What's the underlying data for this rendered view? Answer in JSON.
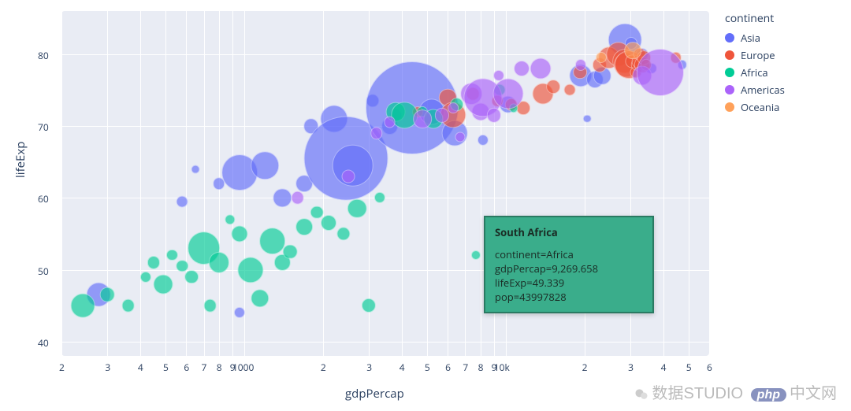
{
  "chart_data": {
    "type": "scatter",
    "xlabel": "gdpPercap",
    "ylabel": "lifeExp",
    "xscale": "log",
    "xlim": [
      200,
      60000
    ],
    "ylim": [
      38,
      86
    ],
    "grid": true,
    "legend_title": "continent",
    "legend_position": "right",
    "size_variable": "pop",
    "series": [
      {
        "name": "Asia",
        "color": "#636efa",
        "points": [
          {
            "x": 277,
            "y": 46.5,
            "pop": 55000000
          },
          {
            "x": 580,
            "y": 59.5,
            "pop": 5000000
          },
          {
            "x": 650,
            "y": 64,
            "pop": 900000
          },
          {
            "x": 800,
            "y": 62,
            "pop": 6000000
          },
          {
            "x": 960,
            "y": 63.5,
            "pop": 150000000
          },
          {
            "x": 960,
            "y": 44,
            "pop": 4000000
          },
          {
            "x": 1200,
            "y": 64.5,
            "pop": 80000000
          },
          {
            "x": 1400,
            "y": 60,
            "pop": 25000000
          },
          {
            "x": 1700,
            "y": 62,
            "pop": 20000000
          },
          {
            "x": 1800,
            "y": 70,
            "pop": 14000000
          },
          {
            "x": 2200,
            "y": 71,
            "pop": 78000000
          },
          {
            "x": 2450,
            "y": 65.5,
            "pop": 1034000000
          },
          {
            "x": 2600,
            "y": 64.5,
            "pop": 210000000
          },
          {
            "x": 3100,
            "y": 73.5,
            "pop": 9000000
          },
          {
            "x": 3600,
            "y": 70,
            "pop": 20000000
          },
          {
            "x": 3800,
            "y": 71.5,
            "pop": 6000000
          },
          {
            "x": 4400,
            "y": 72.5,
            "pop": 1280000000
          },
          {
            "x": 5200,
            "y": 72,
            "pop": 67000000
          },
          {
            "x": 6400,
            "y": 69,
            "pop": 65000000
          },
          {
            "x": 8200,
            "y": 68,
            "pop": 4000000
          },
          {
            "x": 10200,
            "y": 73,
            "pop": 23000000
          },
          {
            "x": 19400,
            "y": 77,
            "pop": 47000000
          },
          {
            "x": 20500,
            "y": 71,
            "pop": 700000
          },
          {
            "x": 22000,
            "y": 76.5,
            "pop": 21000000
          },
          {
            "x": 23400,
            "y": 77,
            "pop": 22000000
          },
          {
            "x": 28600,
            "y": 82,
            "pop": 127000000
          },
          {
            "x": 36000,
            "y": 78,
            "pop": 4200000
          },
          {
            "x": 33300,
            "y": 80,
            "pop": 6900000
          },
          {
            "x": 30200,
            "y": 81.5,
            "pop": 6700000
          },
          {
            "x": 47300,
            "y": 78.5,
            "pop": 2100000
          }
        ]
      },
      {
        "name": "Europe",
        "color": "#EF553B",
        "points": [
          {
            "x": 4600,
            "y": 72,
            "pop": 3500000
          },
          {
            "x": 6000,
            "y": 74,
            "pop": 22000000
          },
          {
            "x": 6300,
            "y": 71.5,
            "pop": 67000000
          },
          {
            "x": 7500,
            "y": 74.5,
            "pop": 8000000
          },
          {
            "x": 9300,
            "y": 73.5,
            "pop": 4500000
          },
          {
            "x": 10500,
            "y": 73,
            "pop": 7500000
          },
          {
            "x": 11700,
            "y": 72.5,
            "pop": 10000000
          },
          {
            "x": 13900,
            "y": 74.5,
            "pop": 38000000
          },
          {
            "x": 15200,
            "y": 75.5,
            "pop": 10000000
          },
          {
            "x": 17600,
            "y": 75,
            "pop": 5000000
          },
          {
            "x": 19200,
            "y": 77.5,
            "pop": 10000000
          },
          {
            "x": 22800,
            "y": 78.5,
            "pop": 10800000
          },
          {
            "x": 24800,
            "y": 79.5,
            "pop": 40000000
          },
          {
            "x": 27000,
            "y": 80,
            "pop": 58000000
          },
          {
            "x": 28500,
            "y": 79,
            "pop": 59000000
          },
          {
            "x": 28900,
            "y": 78.5,
            "pop": 60000000
          },
          {
            "x": 29500,
            "y": 78.5,
            "pop": 82000000
          },
          {
            "x": 30500,
            "y": 79,
            "pop": 9000000
          },
          {
            "x": 31500,
            "y": 77.5,
            "pop": 5400000
          },
          {
            "x": 31700,
            "y": 78.5,
            "pop": 4500000
          },
          {
            "x": 32200,
            "y": 79,
            "pop": 8000000
          },
          {
            "x": 32500,
            "y": 80,
            "pop": 7300000
          },
          {
            "x": 33200,
            "y": 78.5,
            "pop": 16000000
          },
          {
            "x": 33700,
            "y": 79.5,
            "pop": 10000000
          },
          {
            "x": 34400,
            "y": 78.5,
            "pop": 4000000
          },
          {
            "x": 44700,
            "y": 79.5,
            "pop": 4500000
          }
        ]
      },
      {
        "name": "Africa",
        "color": "#00cc96",
        "points": [
          {
            "x": 241,
            "y": 45,
            "pop": 55000000
          },
          {
            "x": 300,
            "y": 46.5,
            "pop": 12000000
          },
          {
            "x": 360,
            "y": 45,
            "pop": 8000000
          },
          {
            "x": 420,
            "y": 49,
            "pop": 4000000
          },
          {
            "x": 450,
            "y": 51,
            "pop": 7000000
          },
          {
            "x": 490,
            "y": 48,
            "pop": 30000000
          },
          {
            "x": 530,
            "y": 52,
            "pop": 4000000
          },
          {
            "x": 580,
            "y": 50.5,
            "pop": 6000000
          },
          {
            "x": 630,
            "y": 49,
            "pop": 10000000
          },
          {
            "x": 700,
            "y": 53,
            "pop": 120000000
          },
          {
            "x": 740,
            "y": 45,
            "pop": 8000000
          },
          {
            "x": 800,
            "y": 51,
            "pop": 35000000
          },
          {
            "x": 880,
            "y": 57,
            "pop": 3000000
          },
          {
            "x": 960,
            "y": 55,
            "pop": 18000000
          },
          {
            "x": 1060,
            "y": 50,
            "pop": 67000000
          },
          {
            "x": 1150,
            "y": 46,
            "pop": 25000000
          },
          {
            "x": 1280,
            "y": 54,
            "pop": 70000000
          },
          {
            "x": 1400,
            "y": 51,
            "pop": 16000000
          },
          {
            "x": 1500,
            "y": 52.5,
            "pop": 12000000
          },
          {
            "x": 1700,
            "y": 56,
            "pop": 20000000
          },
          {
            "x": 1900,
            "y": 58,
            "pop": 8000000
          },
          {
            "x": 2100,
            "y": 56.5,
            "pop": 15000000
          },
          {
            "x": 2400,
            "y": 55,
            "pop": 9000000
          },
          {
            "x": 2700,
            "y": 58.5,
            "pop": 29000000
          },
          {
            "x": 3000,
            "y": 45,
            "pop": 11000000
          },
          {
            "x": 3300,
            "y": 60,
            "pop": 4000000
          },
          {
            "x": 3800,
            "y": 72,
            "pop": 30000000
          },
          {
            "x": 4100,
            "y": 71.5,
            "pop": 68000000
          },
          {
            "x": 4800,
            "y": 72,
            "pop": 4000000
          },
          {
            "x": 5300,
            "y": 71,
            "pop": 31000000
          },
          {
            "x": 6500,
            "y": 73,
            "pop": 10000000
          },
          {
            "x": 7700,
            "y": 52,
            "pop": 1800000
          },
          {
            "x": 9270,
            "y": 49.3,
            "pop": 43997828
          },
          {
            "x": 9500,
            "y": 75,
            "pop": 5000000
          },
          {
            "x": 10700,
            "y": 72.5,
            "pop": 1200000
          },
          {
            "x": 12500,
            "y": 57,
            "pop": 450000
          }
        ]
      },
      {
        "name": "Americas",
        "color": "#ab63fa",
        "points": [
          {
            "x": 1600,
            "y": 60,
            "pop": 8000000
          },
          {
            "x": 2500,
            "y": 63,
            "pop": 8400000
          },
          {
            "x": 3200,
            "y": 69,
            "pop": 6000000
          },
          {
            "x": 3600,
            "y": 70.5,
            "pop": 5000000
          },
          {
            "x": 4800,
            "y": 71,
            "pop": 26000000
          },
          {
            "x": 5700,
            "y": 71.5,
            "pop": 11000000
          },
          {
            "x": 6300,
            "y": 72.5,
            "pop": 3400000
          },
          {
            "x": 6700,
            "y": 68.5,
            "pop": 2700000
          },
          {
            "x": 7400,
            "y": 74.5,
            "pop": 41000000
          },
          {
            "x": 8000,
            "y": 72,
            "pop": 24000000
          },
          {
            "x": 8200,
            "y": 74,
            "pop": 180000000
          },
          {
            "x": 9000,
            "y": 71.5,
            "pop": 11200000
          },
          {
            "x": 9400,
            "y": 77,
            "pop": 4000000
          },
          {
            "x": 10200,
            "y": 74.5,
            "pop": 102000000
          },
          {
            "x": 11500,
            "y": 78,
            "pop": 15000000
          },
          {
            "x": 13600,
            "y": 78,
            "pop": 38000000
          },
          {
            "x": 19300,
            "y": 78.5,
            "pop": 3900000
          },
          {
            "x": 33300,
            "y": 77,
            "pop": 31000000
          },
          {
            "x": 39100,
            "y": 77.5,
            "pop": 287000000
          }
        ]
      },
      {
        "name": "Oceania",
        "color": "#FFA15A",
        "points": [
          {
            "x": 23200,
            "y": 79.5,
            "pop": 3900000
          },
          {
            "x": 30700,
            "y": 80.5,
            "pop": 19500000
          }
        ]
      }
    ]
  },
  "hover": {
    "name": "South Africa",
    "lines": [
      "continent=Africa",
      "gdpPercap=9,269.658",
      "lifeExp=49.339",
      "pop=43997828"
    ]
  },
  "xticks_major": [
    {
      "v": 1000,
      "label": "1000"
    },
    {
      "v": 10000,
      "label": "10k"
    }
  ],
  "xticks_minor": [
    200,
    300,
    400,
    500,
    600,
    700,
    800,
    900,
    2000,
    3000,
    4000,
    5000,
    6000,
    7000,
    8000,
    9000,
    20000,
    30000,
    40000,
    50000,
    60000
  ],
  "xticks_minor_labels": [
    {
      "v": 200,
      "label": "2"
    },
    {
      "v": 300,
      "label": "3"
    },
    {
      "v": 400,
      "label": "4"
    },
    {
      "v": 500,
      "label": "5"
    },
    {
      "v": 600,
      "label": "6"
    },
    {
      "v": 700,
      "label": "7"
    },
    {
      "v": 800,
      "label": "8"
    },
    {
      "v": 900,
      "label": "9"
    },
    {
      "v": 2000,
      "label": "2"
    },
    {
      "v": 3000,
      "label": "3"
    },
    {
      "v": 4000,
      "label": "4"
    },
    {
      "v": 5000,
      "label": "5"
    },
    {
      "v": 6000,
      "label": "6"
    },
    {
      "v": 7000,
      "label": "7"
    },
    {
      "v": 8000,
      "label": "8"
    },
    {
      "v": 9000,
      "label": "9"
    },
    {
      "v": 20000,
      "label": "2"
    },
    {
      "v": 30000,
      "label": "3"
    },
    {
      "v": 40000,
      "label": "4"
    },
    {
      "v": 50000,
      "label": "5"
    },
    {
      "v": 60000,
      "label": "6"
    }
  ],
  "yticks": [
    40,
    50,
    60,
    70,
    80
  ],
  "colors": {
    "Asia": "#636efa",
    "Europe": "#EF553B",
    "Africa": "#00cc96",
    "Americas": "#ab63fa",
    "Oceania": "#FFA15A"
  },
  "watermark": {
    "left": "数据STUDIO",
    "right": "中文网",
    "brand": "php"
  }
}
